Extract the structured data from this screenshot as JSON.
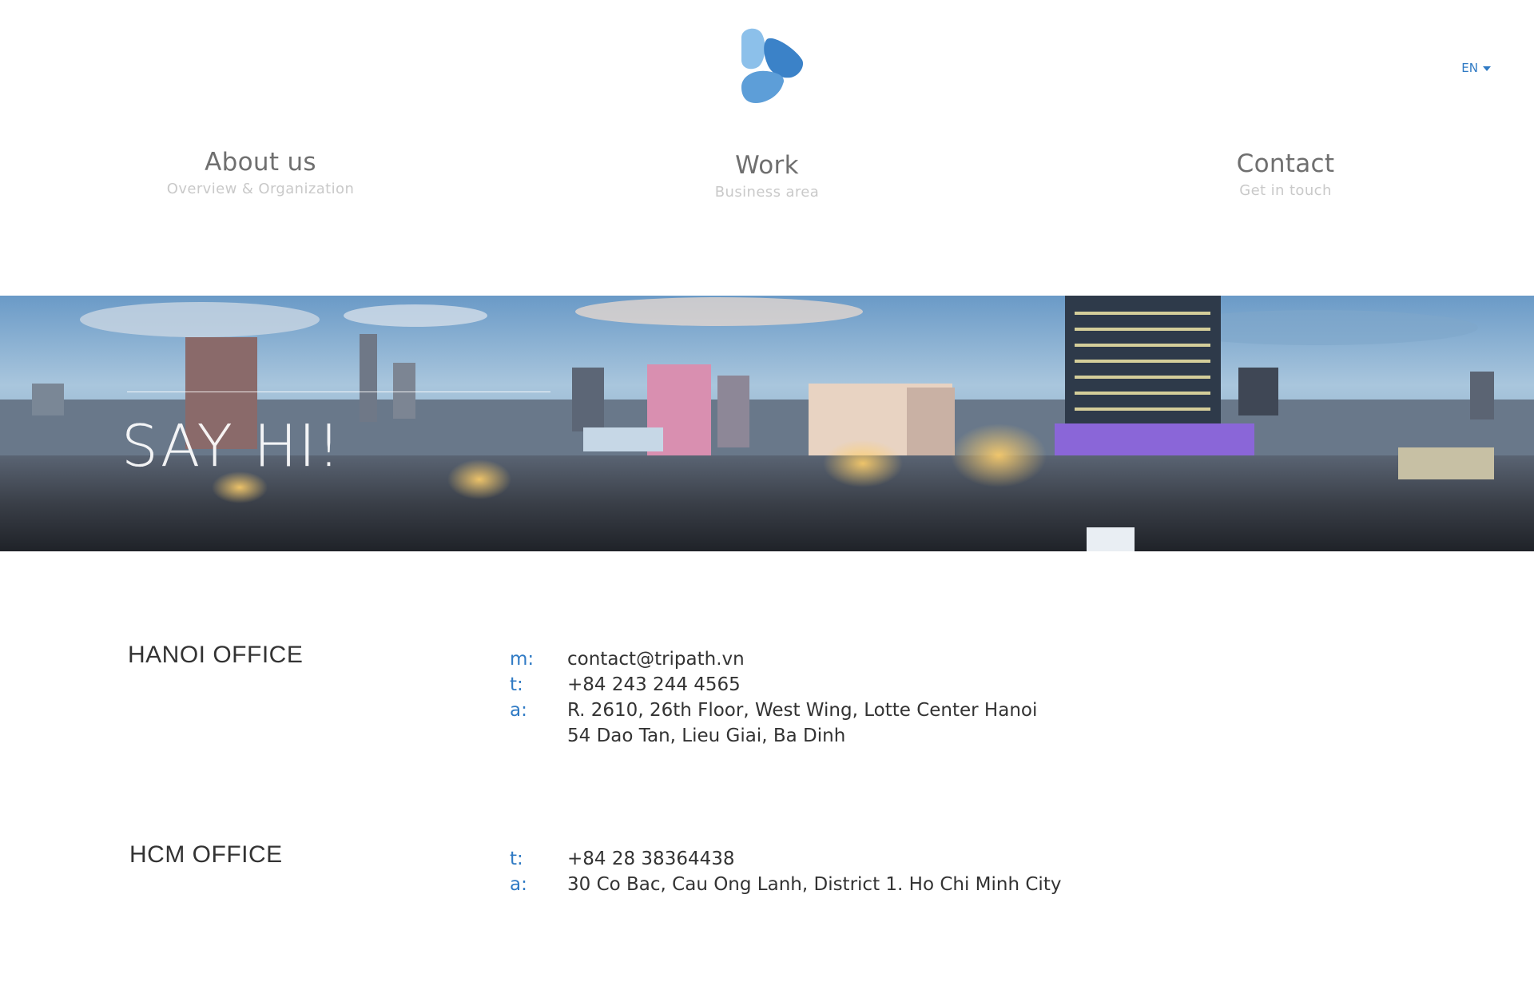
{
  "header": {
    "logo_icon": "tripath-logo-icon",
    "language": "EN",
    "colors": {
      "accent": "#2f7ac4",
      "logo_light": "#8cc0ea",
      "logo_mid": "#5d9ed8",
      "logo_dark": "#3b82c8"
    }
  },
  "nav": {
    "items": [
      {
        "label": "About us",
        "sub": "Overview & Organization"
      },
      {
        "label": "Work",
        "sub": "Business area"
      },
      {
        "label": "Contact",
        "sub": "Get in touch"
      }
    ]
  },
  "banner": {
    "title": "SAY HI!"
  },
  "offices": [
    {
      "name": "HANOI OFFICE",
      "details": [
        {
          "key": "m:",
          "value": "contact@tripath.vn"
        },
        {
          "key": "t:",
          "value": "+84 243 244 4565"
        },
        {
          "key": "a:",
          "value": "R. 2610, 26th Floor, West Wing, Lotte Center Hanoi"
        },
        {
          "key": "",
          "value": "54 Dao Tan, Lieu Giai, Ba Dinh"
        }
      ]
    },
    {
      "name": "HCM OFFICE",
      "details": [
        {
          "key": "t:",
          "value": "+84 28 38364438"
        },
        {
          "key": "a:",
          "value": "30 Co Bac, Cau Ong Lanh, District 1. Ho Chi Minh City"
        }
      ]
    }
  ]
}
